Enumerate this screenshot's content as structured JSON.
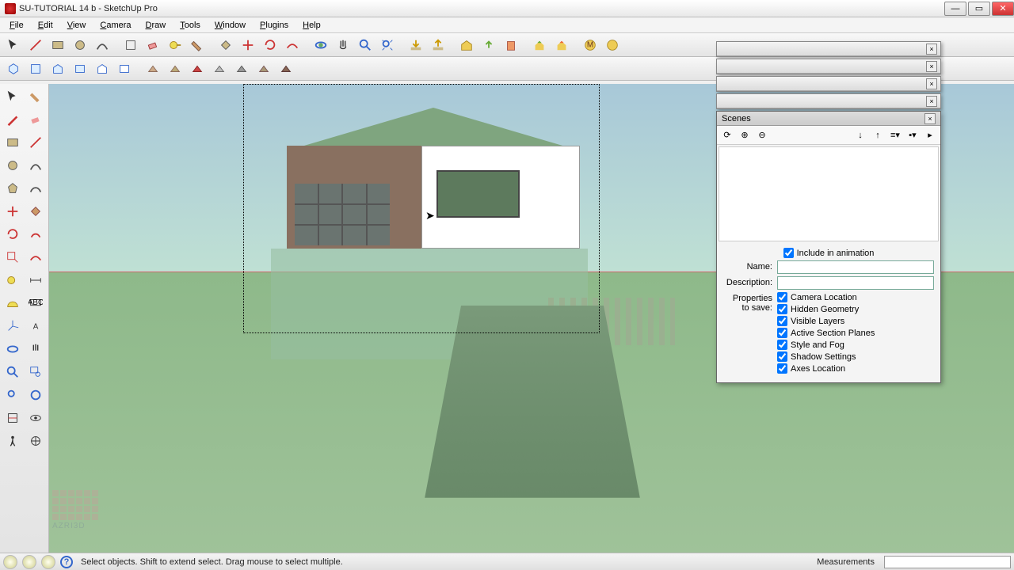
{
  "title": "SU-TUTORIAL 14 b - SketchUp Pro",
  "menu": [
    "File",
    "Edit",
    "View",
    "Camera",
    "Draw",
    "Tools",
    "Window",
    "Plugins",
    "Help"
  ],
  "menu_accel": [
    "F",
    "E",
    "V",
    "C",
    "D",
    "T",
    "W",
    "P",
    "H"
  ],
  "scenes": {
    "title": "Scenes",
    "include_label": "Include in animation",
    "include_checked": true,
    "name_label": "Name:",
    "name_value": "",
    "desc_label": "Description:",
    "desc_value": "",
    "props_label": "Properties to save:",
    "props": [
      {
        "label": "Camera Location",
        "checked": true
      },
      {
        "label": "Hidden Geometry",
        "checked": true
      },
      {
        "label": "Visible Layers",
        "checked": true
      },
      {
        "label": "Active Section Planes",
        "checked": true
      },
      {
        "label": "Style and Fog",
        "checked": true
      },
      {
        "label": "Shadow Settings",
        "checked": true
      },
      {
        "label": "Axes Location",
        "checked": true
      }
    ]
  },
  "status": {
    "hint": "Select objects. Shift to extend select. Drag mouse to select multiple.",
    "measurements_label": "Measurements",
    "measurements_value": ""
  },
  "watermark": "AZRI3D",
  "watermark_url": "azri3d.blogspot.com",
  "toolbar_top": [
    "select",
    "line",
    "rectangle",
    "circle",
    "arc",
    "make-component",
    "eraser",
    "tape",
    "paint",
    "push-pull",
    "move",
    "rotate",
    "offset",
    "orbit",
    "pan",
    "zoom",
    "zoom-extents",
    "previous",
    "get-models",
    "share",
    "3d-warehouse",
    "layers",
    "outliner",
    "google",
    "medal",
    "badge"
  ],
  "toolbar_second": [
    "iso",
    "front",
    "house",
    "top",
    "right",
    "back",
    "face1",
    "face2",
    "face3",
    "face4",
    "face5",
    "face6",
    "face7"
  ],
  "left_tools": [
    "select",
    "paint",
    "line",
    "eraser",
    "rectangle",
    "arc",
    "circle",
    "curve",
    "polygon",
    "freehand",
    "move",
    "rotate",
    "scale",
    "push",
    "follow",
    "offset",
    "tape",
    "protractor",
    "dim",
    "text",
    "axes",
    "3dtext",
    "orbit",
    "pan",
    "zoom",
    "zoom-win",
    "zoom-ext",
    "prev",
    "walk",
    "look",
    "section",
    "position"
  ]
}
